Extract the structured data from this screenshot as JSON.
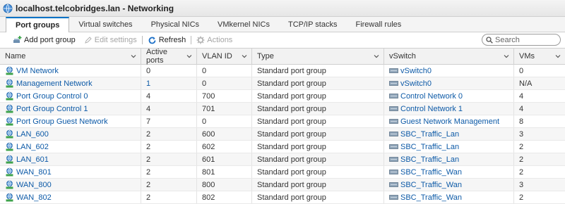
{
  "window": {
    "title": "localhost.telcobridges.lan - Networking"
  },
  "tabs": [
    {
      "label": "Port groups",
      "active": true
    },
    {
      "label": "Virtual switches"
    },
    {
      "label": "Physical NICs"
    },
    {
      "label": "VMkernel NICs"
    },
    {
      "label": "TCP/IP stacks"
    },
    {
      "label": "Firewall rules"
    }
  ],
  "toolbar": {
    "add_port_group": "Add port group",
    "edit_settings": "Edit settings",
    "refresh": "Refresh",
    "actions": "Actions"
  },
  "search": {
    "placeholder": "Search"
  },
  "table": {
    "columns": [
      "Name",
      "Active ports",
      "VLAN ID",
      "Type",
      "vSwitch",
      "VMs"
    ],
    "rows": [
      {
        "name": "VM Network",
        "active_ports": "0",
        "vlan": "0",
        "type": "Standard port group",
        "vswitch": "vSwitch0",
        "vms": "0"
      },
      {
        "name": "Management Network",
        "active_ports": "1",
        "vlan": "0",
        "type": "Standard port group",
        "vswitch": "vSwitch0",
        "vms": "N/A"
      },
      {
        "name": "Port Group Control 0",
        "active_ports": "4",
        "vlan": "700",
        "type": "Standard port group",
        "vswitch": "Control Network 0",
        "vms": "4"
      },
      {
        "name": "Port Group Control 1",
        "active_ports": "4",
        "vlan": "701",
        "type": "Standard port group",
        "vswitch": "Control Network 1",
        "vms": "4"
      },
      {
        "name": "Port Group Guest Network",
        "active_ports": "7",
        "vlan": "0",
        "type": "Standard port group",
        "vswitch": "Guest Network Management",
        "vms": "8"
      },
      {
        "name": "LAN_600",
        "active_ports": "2",
        "vlan": "600",
        "type": "Standard port group",
        "vswitch": "SBC_Traffic_Lan",
        "vms": "3"
      },
      {
        "name": "LAN_602",
        "active_ports": "2",
        "vlan": "602",
        "type": "Standard port group",
        "vswitch": "SBC_Traffic_Lan",
        "vms": "2"
      },
      {
        "name": "LAN_601",
        "active_ports": "2",
        "vlan": "601",
        "type": "Standard port group",
        "vswitch": "SBC_Traffic_Lan",
        "vms": "2"
      },
      {
        "name": "WAN_801",
        "active_ports": "2",
        "vlan": "801",
        "type": "Standard port group",
        "vswitch": "SBC_Traffic_Wan",
        "vms": "2"
      },
      {
        "name": "WAN_800",
        "active_ports": "2",
        "vlan": "800",
        "type": "Standard port group",
        "vswitch": "SBC_Traffic_Wan",
        "vms": "3"
      },
      {
        "name": "WAN_802",
        "active_ports": "2",
        "vlan": "802",
        "type": "Standard port group",
        "vswitch": "SBC_Traffic_Wan",
        "vms": "2"
      }
    ]
  },
  "colors": {
    "accent": "#0072c6",
    "link": "#0d5aa7"
  },
  "icons": {
    "window": "networking-globe-icon",
    "port_group": "port-group-icon",
    "vswitch": "vswitch-icon"
  }
}
